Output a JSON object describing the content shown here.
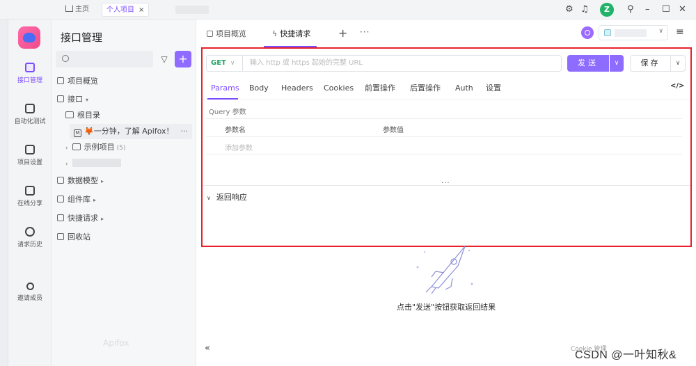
{
  "titlebar": {
    "home_tab": "主页",
    "project_tab": "个人项目",
    "close_symbol": "×",
    "avatar_letter": "Z"
  },
  "rail": {
    "items": [
      {
        "label": "接口管理",
        "icon": "api-icon"
      },
      {
        "label": "自动化测试",
        "icon": "automation-icon"
      },
      {
        "label": "项目设置",
        "icon": "project-settings-icon"
      },
      {
        "label": "在线分享",
        "icon": "share-icon"
      },
      {
        "label": "请求历史",
        "icon": "history-icon"
      },
      {
        "label": "邀请成员",
        "icon": "invite-member-icon"
      }
    ]
  },
  "sidebar": {
    "title": "接口管理",
    "add_symbol": "+",
    "tree": {
      "overview": "项目概览",
      "api": "接口",
      "root": "根目录",
      "apifox_doc": "🦊一分钟，了解 Apifox！",
      "example": "示例项目",
      "example_count": "(5)",
      "data_model": "数据模型",
      "components": "组件库",
      "quick_request": "快捷请求",
      "trash": "回收站"
    },
    "watermark": "Apifox"
  },
  "tabs": {
    "overview": "项目概览",
    "quick_request": "快捷请求"
  },
  "request": {
    "method": "GET",
    "url_placeholder": "输入 http 或 https 起始的完整 URL",
    "send_label": "发送",
    "save_label": "保存"
  },
  "param_tabs": [
    "Params",
    "Body",
    "Headers",
    "Cookies",
    "前置操作",
    "后置操作",
    "Auth",
    "设置"
  ],
  "code_toggle": "</>",
  "query": {
    "section_label": "Query 参数",
    "col_name": "参数名",
    "col_value": "参数值",
    "add_placeholder": "添加参数"
  },
  "response": {
    "toggle_label": "返回响应",
    "empty_hint": "点击\"发送\"按钮获取返回结果"
  },
  "footer": {
    "cookie_manager": "Cookie 管理",
    "watermark": "CSDN @一叶知秋&"
  },
  "colors": {
    "accent": "#7c4dff",
    "highlight_frame": "#e8212a",
    "method_get": "#20a464"
  }
}
